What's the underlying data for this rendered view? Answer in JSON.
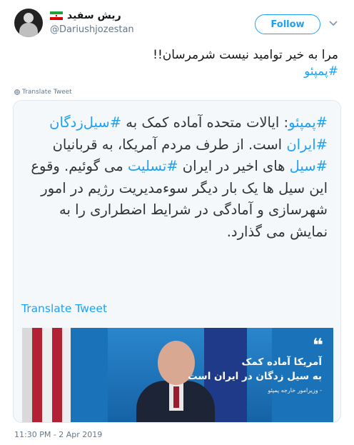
{
  "header": {
    "display_name": "ریش سفید",
    "handle": "@Dariushjozestan",
    "follow_label": "Follow"
  },
  "tweet": {
    "text_line1": "مرا به خیر توامید نیست   شرمرسان!!",
    "hashtag": "#پمپئو",
    "translate_small": "Translate Tweet"
  },
  "quoted": {
    "segments": [
      {
        "text": "#پمپئو",
        "tag": true
      },
      {
        "text": ": ایالات متحده آماده کمک به ",
        "tag": false
      },
      {
        "text": "#سیل‌زدگان",
        "tag": true
      },
      {
        "text": " ",
        "tag": false
      },
      {
        "text": "#ایران",
        "tag": true
      },
      {
        "text": " است.  از طرف مردم آمریکا، به قربانیان ",
        "tag": false
      },
      {
        "text": "#سیل",
        "tag": true
      },
      {
        "text": " های اخیر در ایران ",
        "tag": false
      },
      {
        "text": "#تسلیت",
        "tag": true
      },
      {
        "text": " می گوئیم. وقوع این سیل ها یک بار دیگر سوء‌مدیریت رژیم در امور شهرسازی و آمادگی در شرایط اضطراری را به نمایش می گذارد.",
        "tag": false
      }
    ],
    "translate_label": "Translate Tweet",
    "media": {
      "quote_mark": "❝",
      "overlay_line1": "آمریکا آماده کمک",
      "overlay_line2": "به سیل زدگان در ایران است",
      "overlay_sub": "- وزیرامور خارجه پمپئو"
    }
  },
  "footer": {
    "timestamp": "11:30 PM - 2 Apr 2019"
  },
  "colors": {
    "accent": "#1da1f2",
    "muted": "#657786"
  }
}
